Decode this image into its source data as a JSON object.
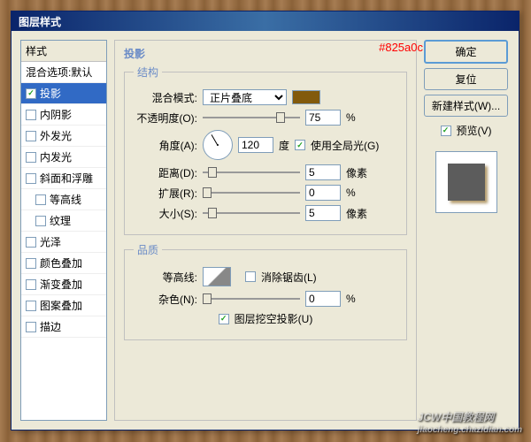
{
  "title": "图层样式",
  "annotation": "#825a0c",
  "sidebar": {
    "header": "样式",
    "items": [
      {
        "label": "混合选项:默认",
        "checkbox": false,
        "checked": false,
        "selected": false
      },
      {
        "label": "投影",
        "checkbox": true,
        "checked": true,
        "selected": true
      },
      {
        "label": "内阴影",
        "checkbox": true,
        "checked": false
      },
      {
        "label": "外发光",
        "checkbox": true,
        "checked": false
      },
      {
        "label": "内发光",
        "checkbox": true,
        "checked": false
      },
      {
        "label": "斜面和浮雕",
        "checkbox": true,
        "checked": false
      },
      {
        "label": "等高线",
        "checkbox": true,
        "checked": false,
        "indent": true
      },
      {
        "label": "纹理",
        "checkbox": true,
        "checked": false,
        "indent": true
      },
      {
        "label": "光泽",
        "checkbox": true,
        "checked": false
      },
      {
        "label": "颜色叠加",
        "checkbox": true,
        "checked": false
      },
      {
        "label": "渐变叠加",
        "checkbox": true,
        "checked": false
      },
      {
        "label": "图案叠加",
        "checkbox": true,
        "checked": false
      },
      {
        "label": "描边",
        "checkbox": true,
        "checked": false
      }
    ]
  },
  "main": {
    "title": "投影",
    "structure_legend": "结构",
    "quality_legend": "品质",
    "blend_mode_label": "混合模式:",
    "blend_mode_value": "正片叠底",
    "opacity_label": "不透明度(O):",
    "opacity_value": "75",
    "angle_label": "角度(A):",
    "angle_value": "120",
    "angle_unit": "度",
    "global_light": "使用全局光(G)",
    "distance_label": "距离(D):",
    "distance_value": "5",
    "spread_label": "扩展(R):",
    "spread_value": "0",
    "size_label": "大小(S):",
    "size_value": "5",
    "pixel_unit": "像素",
    "percent_unit": "%",
    "contour_label": "等高线:",
    "antialias": "消除锯齿(L)",
    "noise_label": "杂色(N):",
    "noise_value": "0",
    "knockout": "图层挖空投影(U)"
  },
  "buttons": {
    "ok": "确定",
    "cancel": "复位",
    "new_style": "新建样式(W)...",
    "preview": "预览(V)"
  },
  "watermark": {
    "main": "JCW中国教程网",
    "sub": "jiaocheng.chazidian.com"
  }
}
